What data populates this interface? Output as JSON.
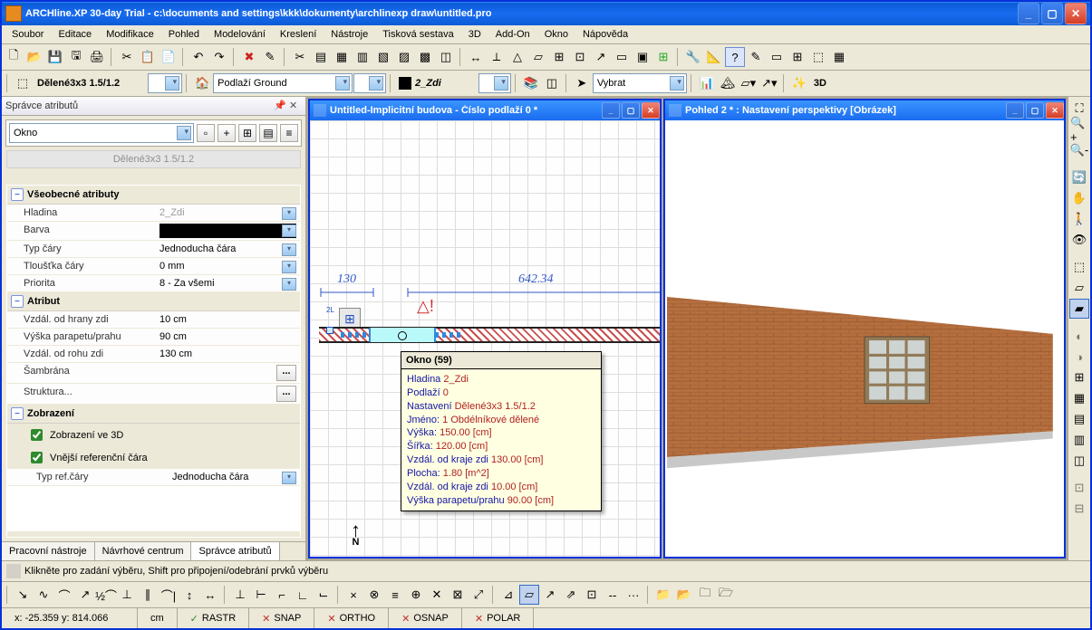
{
  "title": "ARCHline.XP 30-day Trial - c:\\documents and settings\\kkk\\dokumenty\\archlinexp draw\\untitled.pro",
  "menu": [
    "Soubor",
    "Editace",
    "Modifikace",
    "Pohled",
    "Modelování",
    "Kreslení",
    "Nástroje",
    "Tisková sestava",
    "3D",
    "Add-On",
    "Okno",
    "Nápověda"
  ],
  "profile": "Dělené3x3 1.5/1.2",
  "floor": "Podlaží Ground",
  "layer": "2_Zdi",
  "mode": "Vybrat",
  "btn3d": "3D",
  "panel": {
    "title": "Správce atributů",
    "type": "Okno",
    "preset": "Dělené3x3 1.5/1.2",
    "group_general": "Všeobecné atributy",
    "rows_general": [
      {
        "k": "Hladina",
        "v": "2_Zdi",
        "dd": true,
        "grey": true
      },
      {
        "k": "Barva",
        "v": "",
        "swatch": true,
        "dd": true
      },
      {
        "k": "Typ čáry",
        "v": "Jednoducha čára",
        "dd": true
      },
      {
        "k": "Tloušťka čáry",
        "v": "0 mm",
        "dd": true
      },
      {
        "k": "Priorita",
        "v": "8 - Za všemi",
        "dd": true
      }
    ],
    "group_attr": "Atribut",
    "rows_attr": [
      {
        "k": "Vzdál. od hrany zdi",
        "v": "10 cm"
      },
      {
        "k": "Výška parapetu/prahu",
        "v": "90 cm"
      },
      {
        "k": "Vzdál. od rohu zdi",
        "v": "130 cm"
      },
      {
        "k": "Šambrána",
        "v": "",
        "ell": true
      },
      {
        "k": "Struktura...",
        "v": "",
        "ell": true
      }
    ],
    "group_disp": "Zobrazení",
    "chk1": "Zobrazení ve 3D",
    "chk2": "Vnější referenční čára",
    "reftype_k": "Typ ref.čáry",
    "reftype_v": "Jednoducha čára",
    "tabs": [
      "Pracovní nástroje",
      "Návrhové centrum",
      "Správce atributů"
    ]
  },
  "mdi1": {
    "title": "Untitled-Implicitní budova - Číslo podlaží 0 *"
  },
  "mdi2": {
    "title": "Pohled 2 *  : Nastavení perspektivy [Obrázek]"
  },
  "dim1": "130",
  "dim2": "642.34",
  "north": "N",
  "tooltip": {
    "title": "Okno (59)",
    "lines": [
      [
        "Hladina",
        "2_Zdi"
      ],
      [
        "Podlaží",
        "0"
      ],
      [
        "Nastavení",
        "Dělené3x3 1.5/1.2"
      ],
      [
        "Jméno:",
        "1 Obdélníkové dělené"
      ],
      [
        "Výška:",
        "150.00 [cm]"
      ],
      [
        "Šířka:",
        "120.00 [cm]"
      ],
      [
        "Vzdál. od kraje zdi",
        "130.00 [cm]"
      ],
      [
        "Plocha:",
        "1.80 [m^2]"
      ],
      [
        "Vzdál. od kraje zdi",
        "10.00 [cm]"
      ],
      [
        "Výška parapetu/prahu",
        "90.00 [cm]"
      ]
    ]
  },
  "infobar": "Klikněte pro zadání výběru, Shift pro připojení/odebrání prvků výběru",
  "status": {
    "coords": "x: -25.359  y: 814.066",
    "unit": "cm",
    "items": [
      [
        "✓",
        "RASTR"
      ],
      [
        "✕",
        "SNAP"
      ],
      [
        "✕",
        "ORTHO"
      ],
      [
        "✕",
        "OSNAP"
      ],
      [
        "✕",
        "POLAR"
      ]
    ]
  }
}
